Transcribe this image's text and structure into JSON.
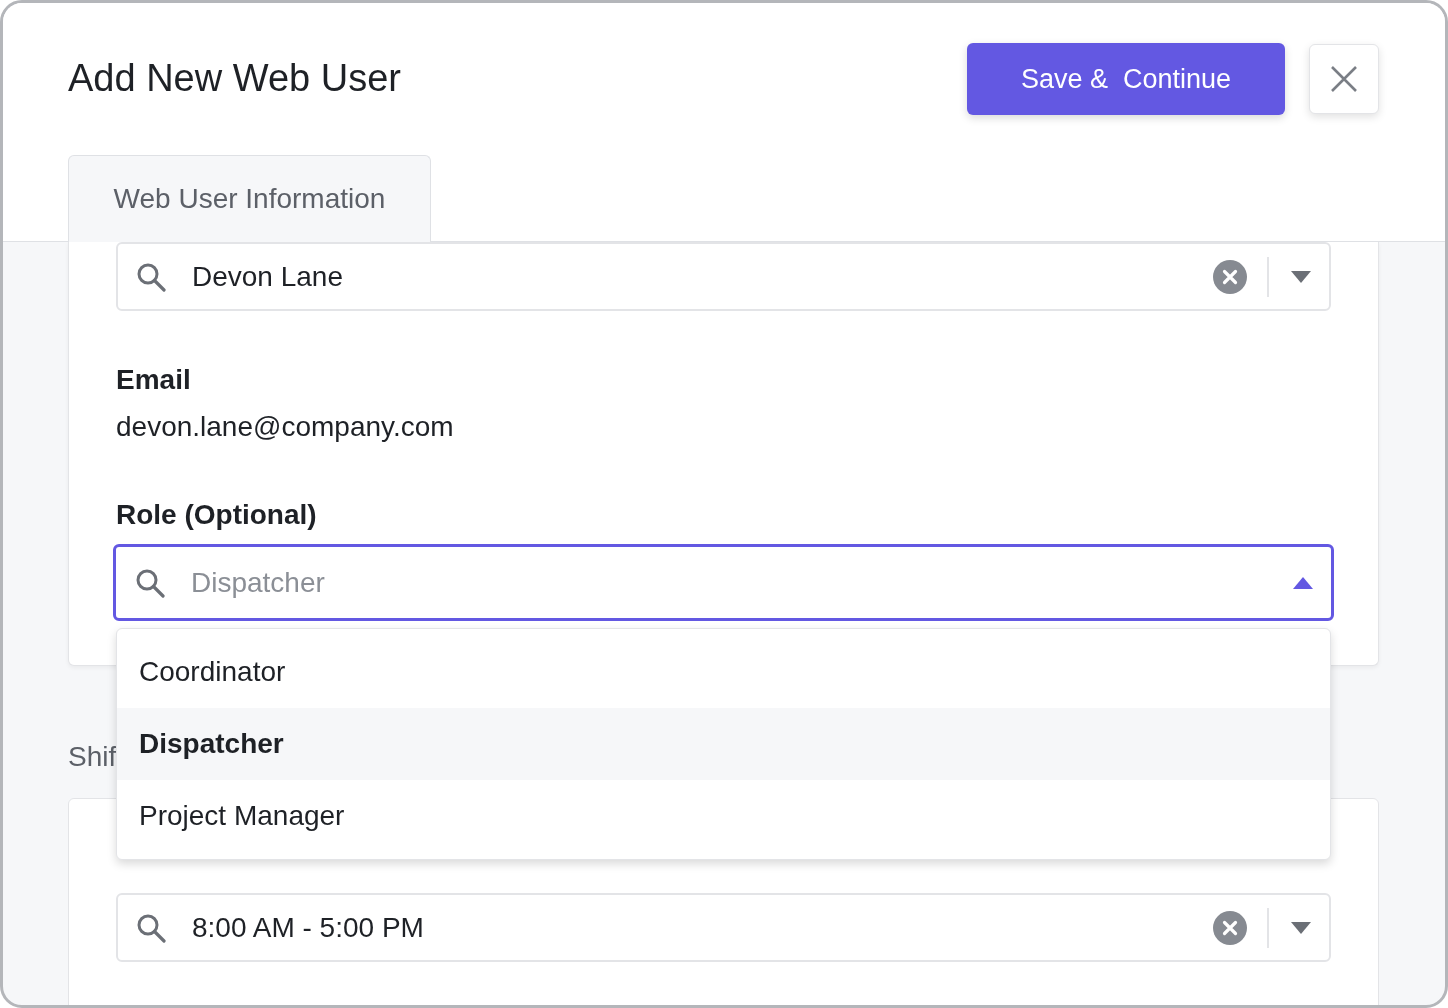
{
  "title": "Add New Web User",
  "save_button": "Save &  Continue",
  "tabs": [
    {
      "label": "Web User Information",
      "selected": true
    }
  ],
  "user_field": {
    "value": "Devon Lane"
  },
  "email": {
    "label": "Email",
    "value": "devon.lane@company.com"
  },
  "role": {
    "label": "Role (Optional)",
    "placeholder": "Dispatcher",
    "expanded": true,
    "options": [
      {
        "label": "Coordinator",
        "selected": false
      },
      {
        "label": "Dispatcher",
        "selected": true
      },
      {
        "label": "Project Manager",
        "selected": false
      }
    ]
  },
  "shift_section": {
    "heading": "Shif",
    "field": {
      "value": "8:00 AM - 5:00 PM"
    }
  }
}
